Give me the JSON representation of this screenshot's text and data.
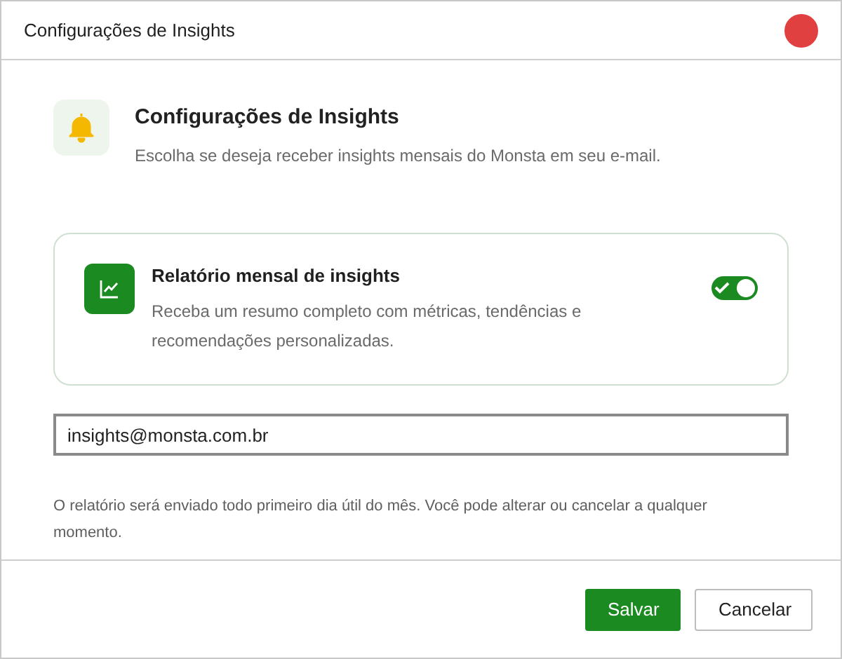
{
  "window": {
    "title": "Configurações de Insights"
  },
  "header": {
    "title": "Configurações de Insights",
    "subtitle": "Escolha se deseja receber insights mensais do Monsta em seu e-mail."
  },
  "option": {
    "title": "Relatório mensal de insights",
    "description": "Receba um resumo completo com métricas, tendências e recomendações personalizadas.",
    "on": true
  },
  "email_field": {
    "value": "insights@monsta.com.br"
  },
  "note": "O relatório será enviado todo primeiro dia útil do mês. Você pode alterar ou cancelar a qualquer momento.",
  "buttons": [
    {
      "label": "Salvar",
      "kind": "primary"
    },
    {
      "label": "Cancelar",
      "kind": "secondary"
    }
  ]
}
